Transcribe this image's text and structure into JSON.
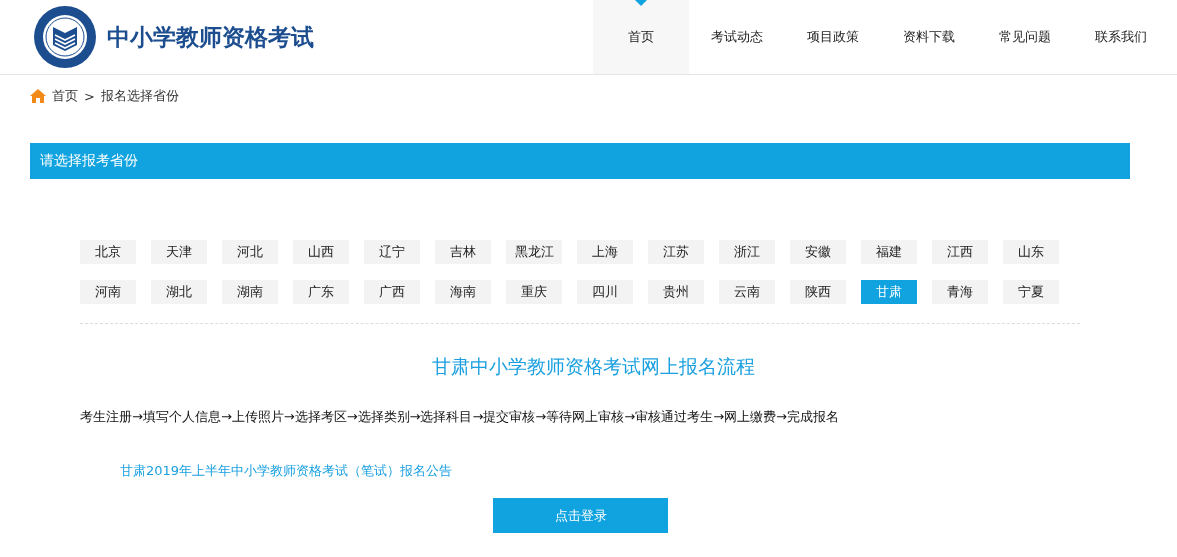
{
  "site_title": "中小学教师资格考试",
  "nav": [
    {
      "label": "首页",
      "selected": true
    },
    {
      "label": "考试动态",
      "selected": false
    },
    {
      "label": "项目政策",
      "selected": false
    },
    {
      "label": "资料下载",
      "selected": false
    },
    {
      "label": "常见问题",
      "selected": false
    },
    {
      "label": "联系我们",
      "selected": false
    }
  ],
  "breadcrumb": {
    "home": "首页",
    "separator": ">",
    "current": "报名选择省份"
  },
  "section_title": "请选择报考省份",
  "provinces": [
    {
      "label": "北京",
      "selected": false
    },
    {
      "label": "天津",
      "selected": false
    },
    {
      "label": "河北",
      "selected": false
    },
    {
      "label": "山西",
      "selected": false
    },
    {
      "label": "辽宁",
      "selected": false
    },
    {
      "label": "吉林",
      "selected": false
    },
    {
      "label": "黑龙江",
      "selected": false
    },
    {
      "label": "上海",
      "selected": false
    },
    {
      "label": "江苏",
      "selected": false
    },
    {
      "label": "浙江",
      "selected": false
    },
    {
      "label": "安徽",
      "selected": false
    },
    {
      "label": "福建",
      "selected": false
    },
    {
      "label": "江西",
      "selected": false
    },
    {
      "label": "山东",
      "selected": false
    },
    {
      "label": "河南",
      "selected": false
    },
    {
      "label": "湖北",
      "selected": false
    },
    {
      "label": "湖南",
      "selected": false
    },
    {
      "label": "广东",
      "selected": false
    },
    {
      "label": "广西",
      "selected": false
    },
    {
      "label": "海南",
      "selected": false
    },
    {
      "label": "重庆",
      "selected": false
    },
    {
      "label": "四川",
      "selected": false
    },
    {
      "label": "贵州",
      "selected": false
    },
    {
      "label": "云南",
      "selected": false
    },
    {
      "label": "陕西",
      "selected": false
    },
    {
      "label": "甘肃",
      "selected": true
    },
    {
      "label": "青海",
      "selected": false
    },
    {
      "label": "宁夏",
      "selected": false
    }
  ],
  "process_title": "甘肃中小学教师资格考试网上报名流程",
  "process_steps": "考生注册→填写个人信息→上传照片→选择考区→选择类别→选择科目→提交审核→等待网上审核→审核通过考生→网上缴费→完成报名",
  "notice_link": "甘肃2019年上半年中小学教师资格考试（笔试）报名公告",
  "login_button": "点击登录"
}
